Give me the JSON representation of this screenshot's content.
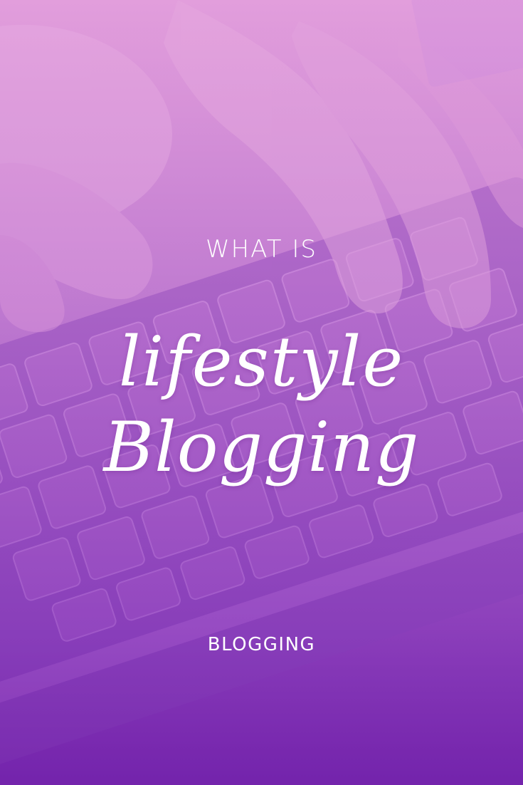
{
  "pin": {
    "kicker": "WHAT IS",
    "title_line_1": "lifestyle",
    "title_line_2": "Blogging",
    "category": "BLOGGING"
  },
  "colors": {
    "overlay_top": "#d99ad8",
    "overlay_bottom": "#7324ad",
    "text": "#ffffff"
  }
}
